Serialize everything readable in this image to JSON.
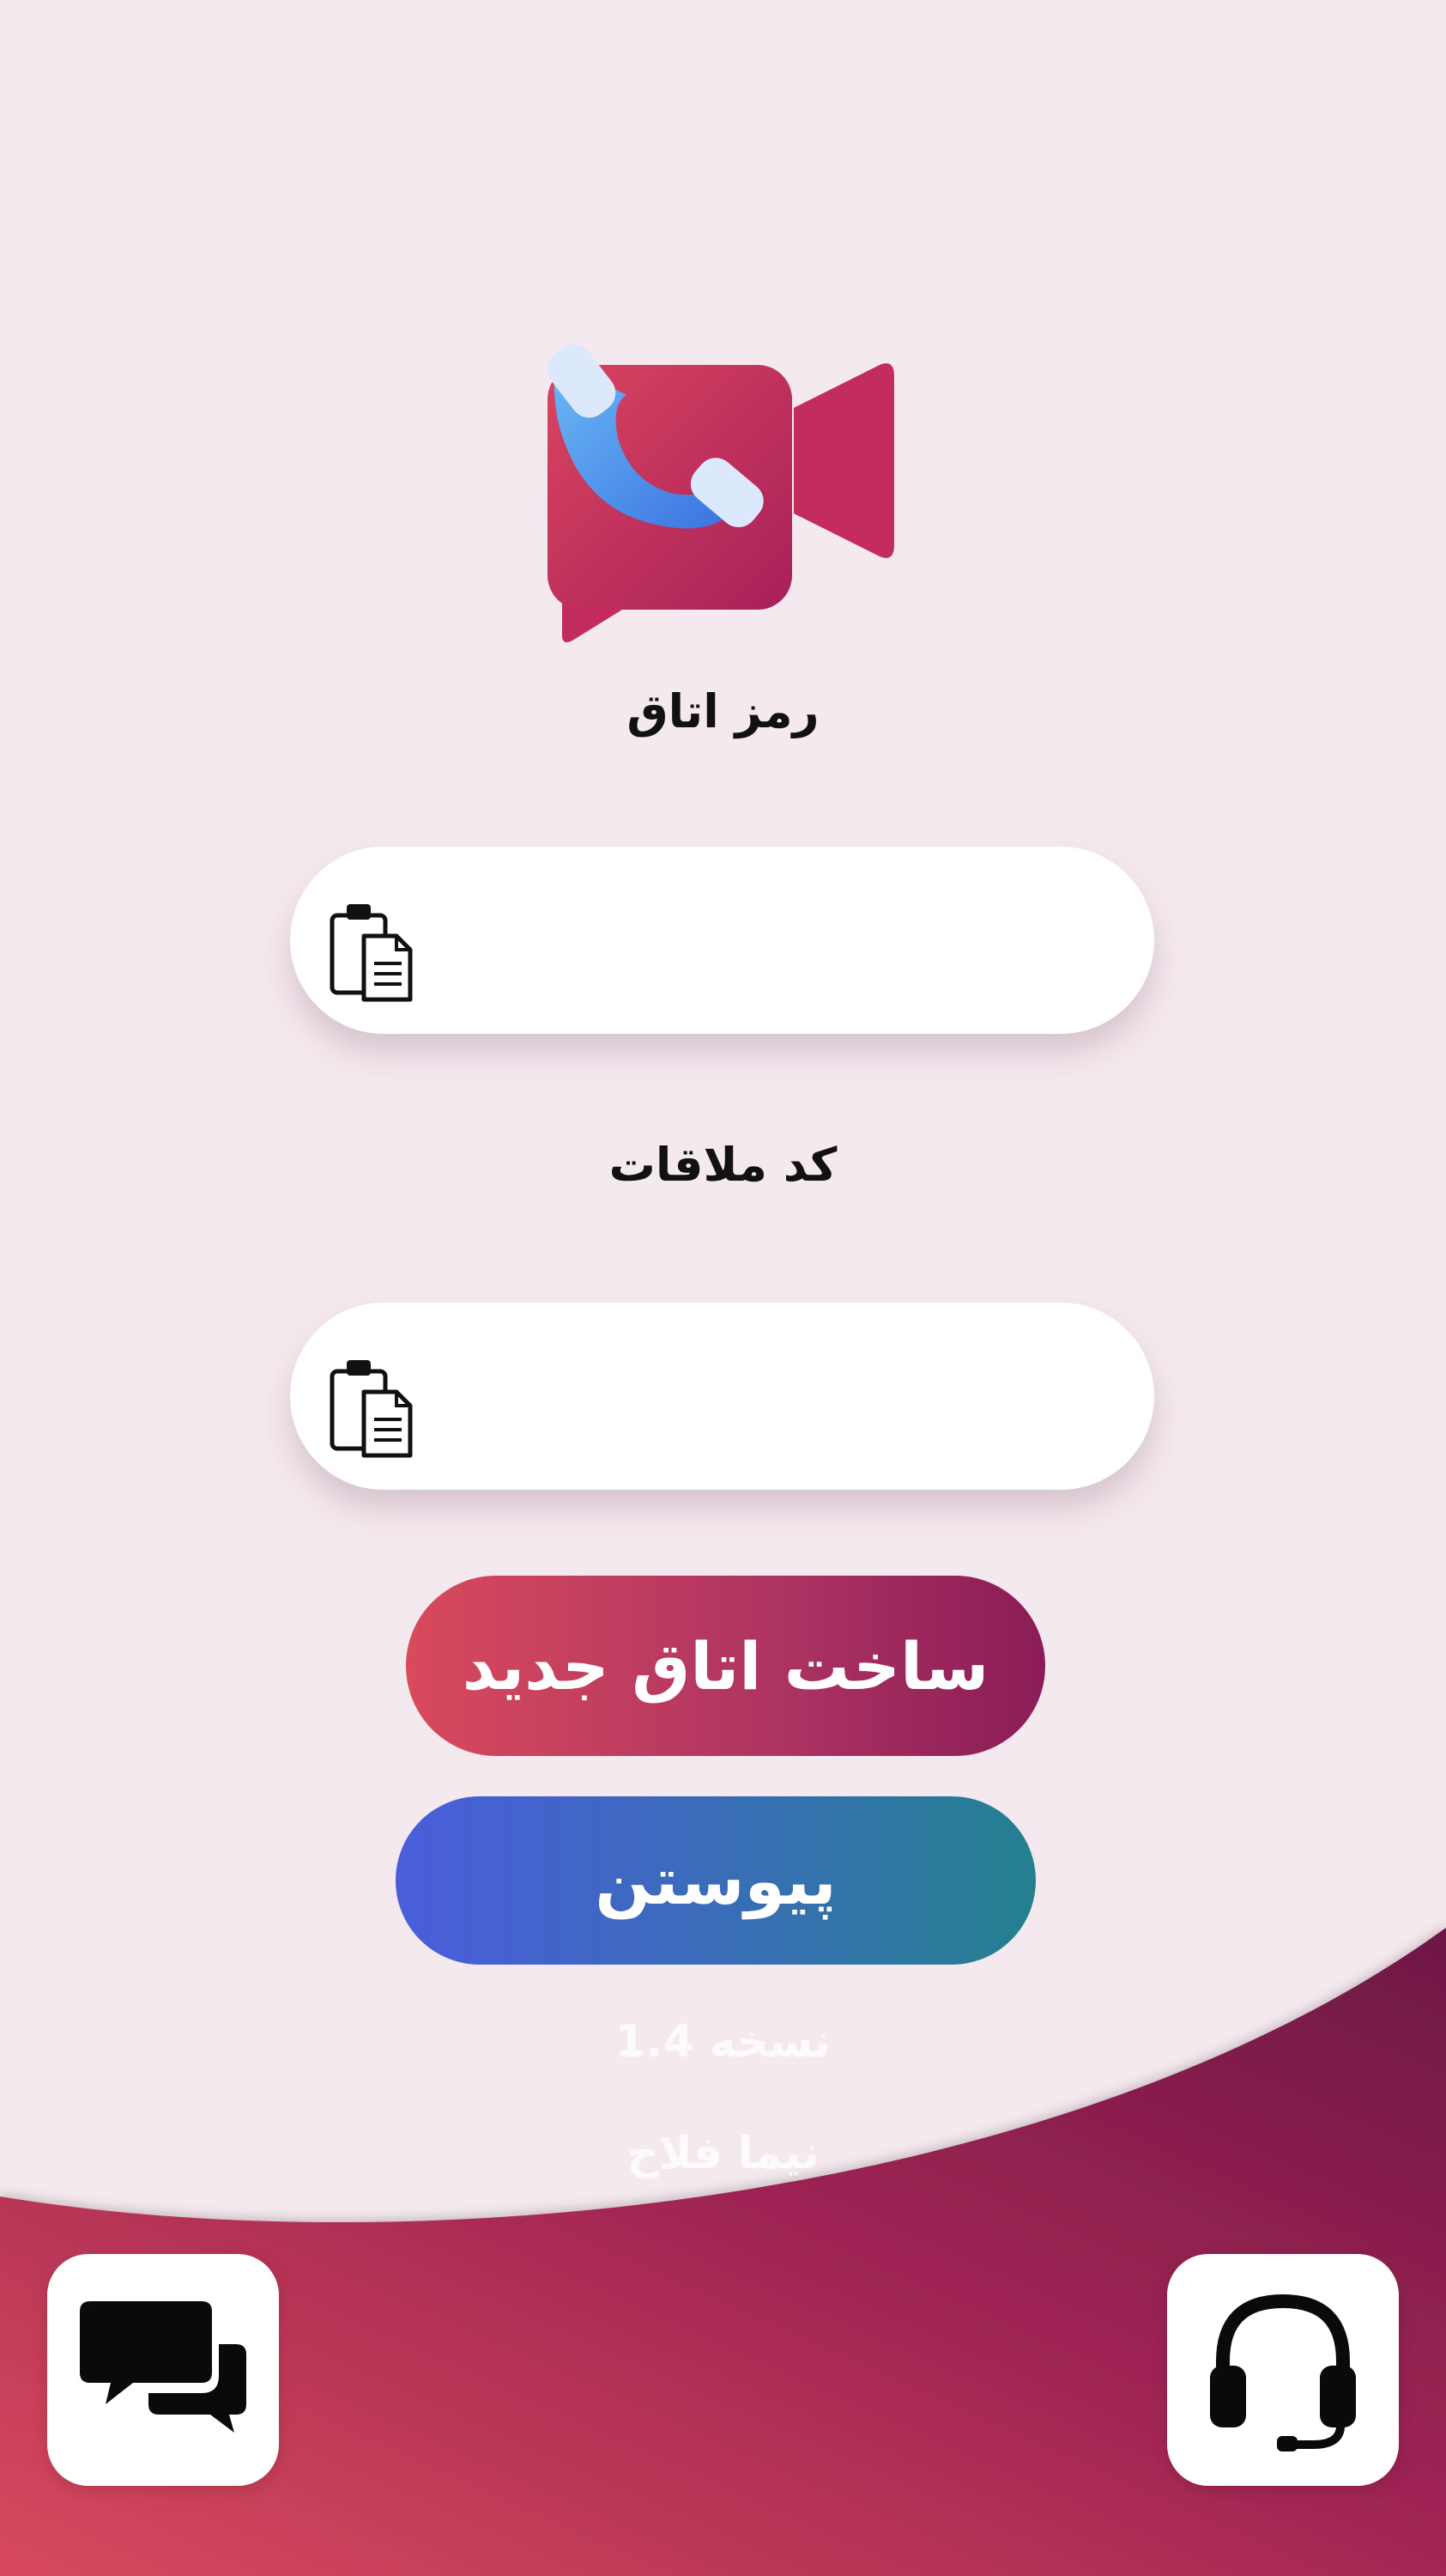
{
  "form": {
    "room_password_label": "رمز اتاق",
    "meeting_code_label": "کد ملاقات",
    "room_password_value": "",
    "meeting_code_value": ""
  },
  "buttons": {
    "create_room": "ساخت اتاق جدید",
    "join": "پیوستن"
  },
  "footer": {
    "version": "نسخه 1.4",
    "author": "نیما فلاح"
  },
  "icons": {
    "logo": "video-call-icon",
    "paste": "clipboard-paste-icon",
    "chat": "chat-icon",
    "support": "headset-icon"
  },
  "colors": {
    "background": "#f4e9ee",
    "wave_start": "#d84a5c",
    "wave_end": "#6e1845",
    "create_start": "#d84a5c",
    "create_end": "#8a1c57",
    "join_start": "#4a5ddb",
    "join_end": "#24808f"
  }
}
